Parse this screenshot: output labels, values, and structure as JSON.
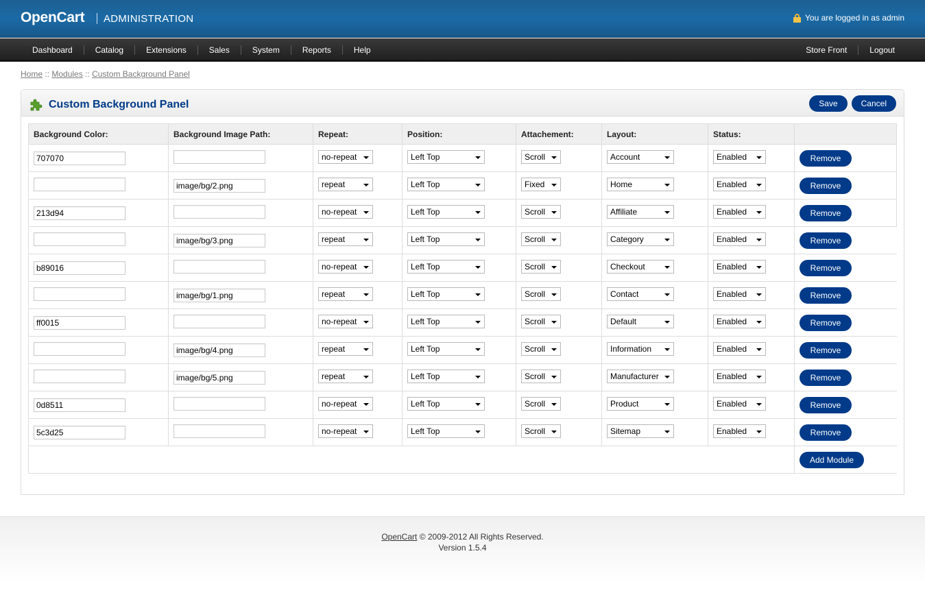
{
  "header": {
    "brand": "OpenCart",
    "section": "ADMINISTRATION",
    "login_text": "You are logged in as admin"
  },
  "menu": {
    "left": [
      "Dashboard",
      "Catalog",
      "Extensions",
      "Sales",
      "System",
      "Reports",
      "Help"
    ],
    "right": [
      "Store Front",
      "Logout"
    ]
  },
  "breadcrumb": {
    "items": [
      "Home",
      "Modules",
      "Custom Background Panel"
    ],
    "separator": "::"
  },
  "panel": {
    "title": "Custom Background Panel",
    "save_label": "Save",
    "cancel_label": "Cancel",
    "columns": [
      "Background Color:",
      "Background Image Path:",
      "Repeat:",
      "Position:",
      "Attachement:",
      "Layout:",
      "Status:",
      ""
    ],
    "remove_label": "Remove",
    "add_label": "Add Module",
    "rows": [
      {
        "color": "707070",
        "image": "",
        "repeat": "no-repeat",
        "position": "Left Top",
        "attachment": "Scroll",
        "layout": "Account",
        "status": "Enabled"
      },
      {
        "color": "",
        "image": "image/bg/2.png",
        "repeat": "repeat",
        "position": "Left Top",
        "attachment": "Fixed",
        "layout": "Home",
        "status": "Enabled"
      },
      {
        "color": "213d94",
        "image": "",
        "repeat": "no-repeat",
        "position": "Left Top",
        "attachment": "Scroll",
        "layout": "Affiliate",
        "status": "Enabled"
      },
      {
        "color": "",
        "image": "image/bg/3.png",
        "repeat": "repeat",
        "position": "Left Top",
        "attachment": "Scroll",
        "layout": "Category",
        "status": "Enabled"
      },
      {
        "color": "b89016",
        "image": "",
        "repeat": "no-repeat",
        "position": "Left Top",
        "attachment": "Scroll",
        "layout": "Checkout",
        "status": "Enabled"
      },
      {
        "color": "",
        "image": "image/bg/1.png",
        "repeat": "repeat",
        "position": "Left Top",
        "attachment": "Scroll",
        "layout": "Contact",
        "status": "Enabled"
      },
      {
        "color": "ff0015",
        "image": "",
        "repeat": "no-repeat",
        "position": "Left Top",
        "attachment": "Scroll",
        "layout": "Default",
        "status": "Enabled"
      },
      {
        "color": "",
        "image": "image/bg/4.png",
        "repeat": "repeat",
        "position": "Left Top",
        "attachment": "Scroll",
        "layout": "Information",
        "status": "Enabled"
      },
      {
        "color": "",
        "image": "image/bg/5.png",
        "repeat": "repeat",
        "position": "Left Top",
        "attachment": "Scroll",
        "layout": "Manufacturer",
        "status": "Enabled"
      },
      {
        "color": "0d8511",
        "image": "",
        "repeat": "no-repeat",
        "position": "Left Top",
        "attachment": "Scroll",
        "layout": "Product",
        "status": "Enabled"
      },
      {
        "color": "5c3d25",
        "image": "",
        "repeat": "no-repeat",
        "position": "Left Top",
        "attachment": "Scroll",
        "layout": "Sitemap",
        "status": "Enabled"
      }
    ]
  },
  "footer": {
    "link": "OpenCart",
    "copyright": "© 2009-2012 All Rights Reserved.",
    "version": "Version 1.5.4"
  },
  "colors": {
    "header_blue": "#1b6aa6",
    "button_blue": "#003a88",
    "title_blue": "#003a88",
    "menu_dark": "#2a2a2a"
  },
  "icons": [
    "lock-icon",
    "puzzle-icon",
    "dropdown-arrow-icon"
  ]
}
